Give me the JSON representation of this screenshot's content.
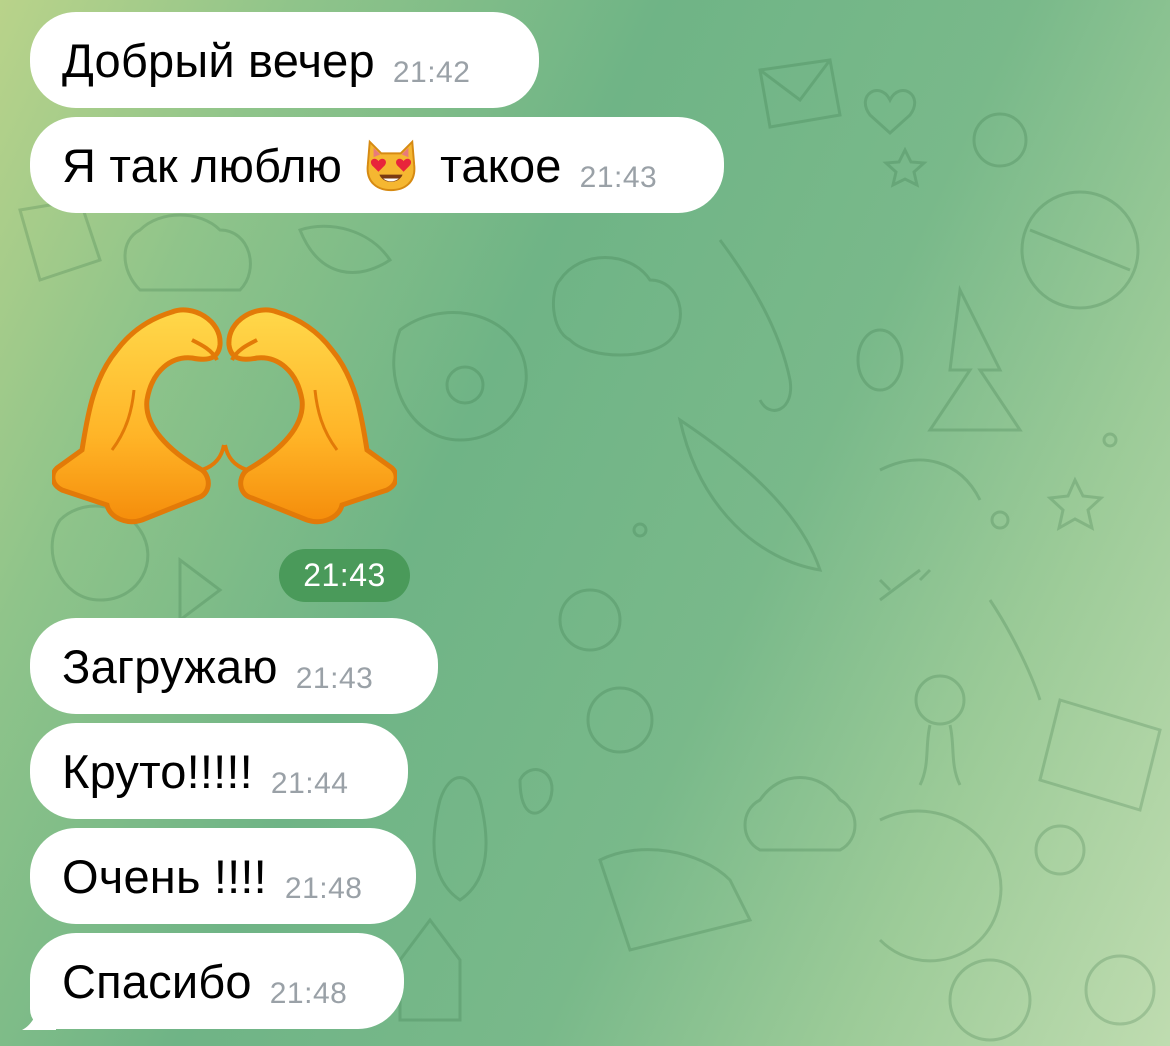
{
  "chat": {
    "messages": [
      {
        "text": "Добрый вечер",
        "time": "21:42"
      },
      {
        "text_before": "Я так люблю",
        "emoji": "smiling-cat-heart-eyes",
        "text_after": "такое",
        "time": "21:43"
      },
      {
        "sticker": "heart-hands",
        "time": "21:43"
      },
      {
        "text": "Загружаю",
        "time": "21:43"
      },
      {
        "text": "Круто!!!!!",
        "time": "21:44"
      },
      {
        "text": "Очень !!!!",
        "time": "21:48"
      },
      {
        "text": "Спасибо",
        "time": "21:48"
      }
    ]
  },
  "colors": {
    "bubble": "#ffffff",
    "time_text": "#9aa1a7",
    "sticker_time_badge": "#4a9a5a",
    "wallpaper_green": "#6fb486"
  }
}
